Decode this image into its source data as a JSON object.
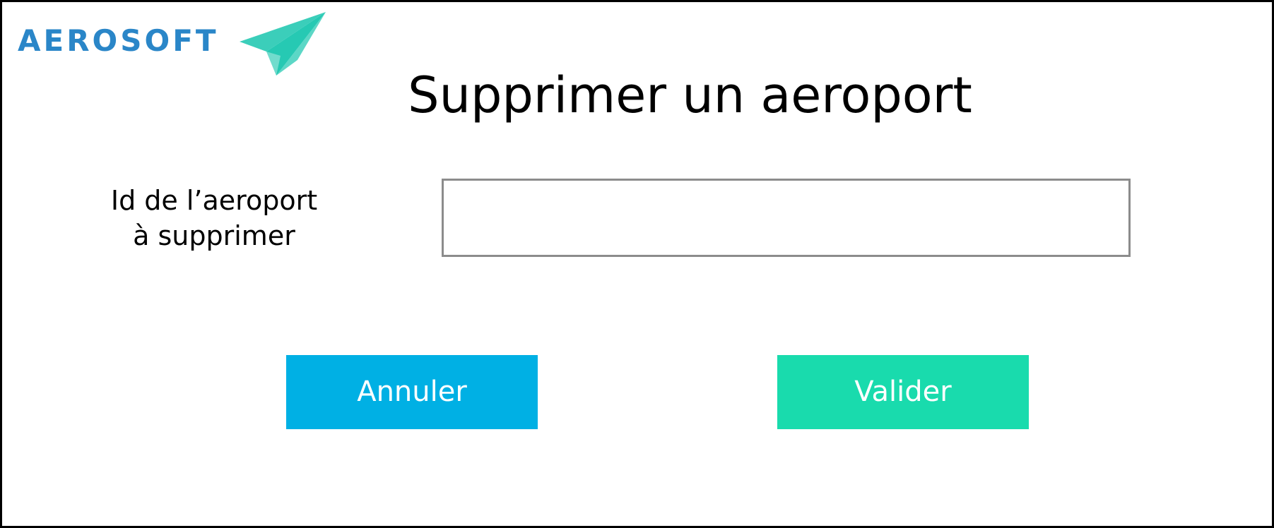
{
  "brand": {
    "name": "AEROSOFT",
    "color": "#2a86c8",
    "icon": "paper-plane-icon",
    "icon_color": "#26c9b3"
  },
  "page": {
    "title": "Supprimer un aeroport"
  },
  "form": {
    "label_line1": "Id de l’aeroport",
    "label_line2": "à supprimer",
    "input_value": "",
    "input_placeholder": ""
  },
  "actions": {
    "cancel_label": "Annuler",
    "cancel_color": "#00b0e4",
    "validate_label": "Valider",
    "validate_color": "#19dbad"
  }
}
